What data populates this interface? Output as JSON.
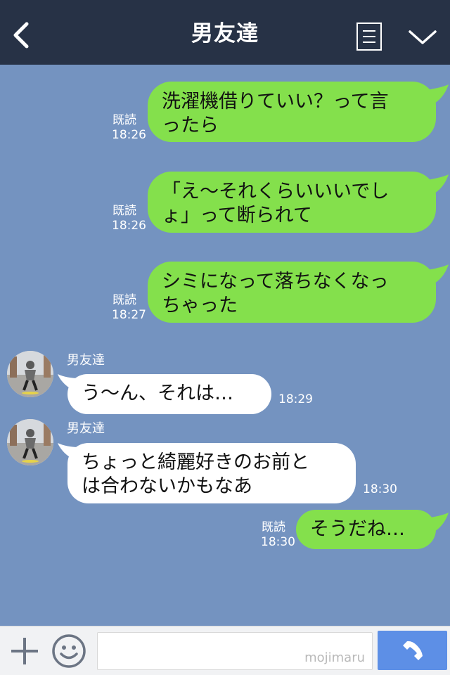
{
  "header": {
    "title": "男友達",
    "icons": [
      "back-arrow-icon",
      "menu-list-icon",
      "chevron-down-icon"
    ]
  },
  "messages": [
    {
      "direction": "outgoing",
      "read": "既読",
      "time": "18:26",
      "text": "洗濯機借りていい？って言\nったら"
    },
    {
      "direction": "outgoing",
      "read": "既読",
      "time": "18:26",
      "text": "「え～それくらいいいでし\nょ」って断られて"
    },
    {
      "direction": "outgoing",
      "read": "既読",
      "time": "18:27",
      "text": "シミになって落ちなくなっ\nちゃった"
    },
    {
      "direction": "incoming",
      "sender": "男友達",
      "time": "18:29",
      "text": "う～ん、それは…"
    },
    {
      "direction": "incoming",
      "sender": "男友達",
      "time": "18:30",
      "text": "ちょっと綺麗好きのお前と\nは合わないかもなあ"
    },
    {
      "direction": "outgoing",
      "read": "既読",
      "time": "18:30",
      "text": "そうだね…"
    }
  ],
  "input_bar": {
    "watermark": "mojimaru",
    "icons": [
      "plus-icon",
      "smile-icon",
      "phone-icon"
    ]
  },
  "colors": {
    "background": "#7493c0",
    "header": "#273246",
    "outgoing_bubble": "#84e04c",
    "incoming_bubble": "#ffffff",
    "call_button": "#5d8fe6"
  }
}
